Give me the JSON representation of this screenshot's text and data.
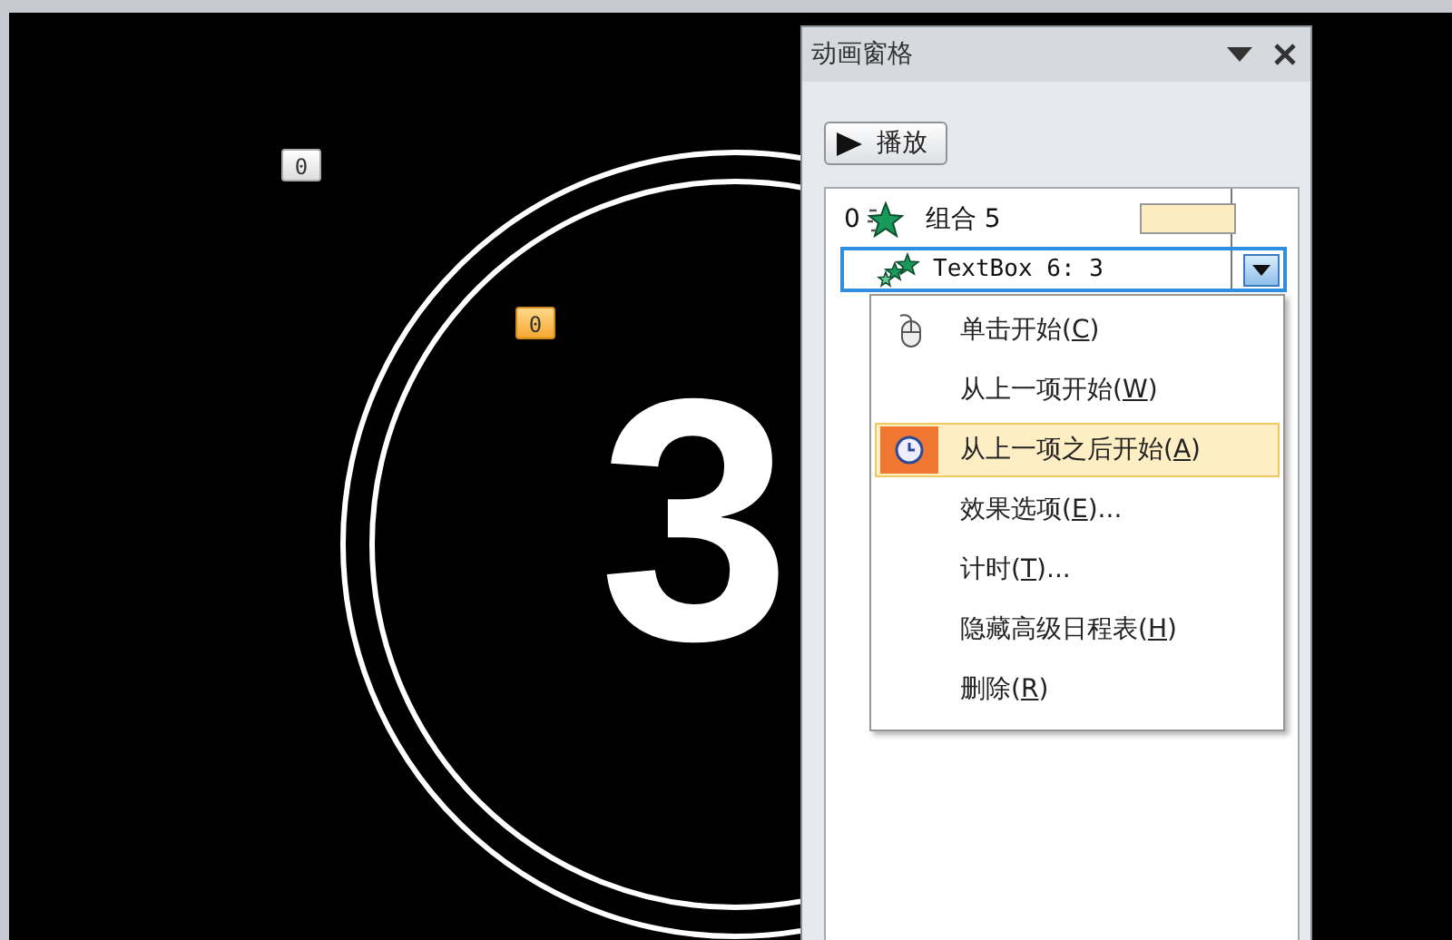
{
  "slide": {
    "badges": [
      {
        "text": "0",
        "selected": false
      },
      {
        "text": "0",
        "selected": true
      }
    ],
    "number": "3"
  },
  "animation_pane": {
    "title": "动画窗格",
    "play_button": {
      "label": "播放"
    },
    "items": [
      {
        "index": "0",
        "name": "组合 5",
        "kind": "group",
        "selected": false
      },
      {
        "name": "TextBox 6: 3",
        "kind": "effect",
        "selected": true
      }
    ],
    "context_menu": [
      {
        "before": "单击开始(",
        "key": "C",
        "after": ")",
        "kind": "mouse",
        "selected": false
      },
      {
        "before": "从上一项开始(",
        "key": "W",
        "after": ")",
        "selected": false
      },
      {
        "before": "从上一项之后开始(",
        "key": "A",
        "after": ")",
        "kind": "clock",
        "selected": true
      },
      {
        "before": "效果选项(",
        "key": "E",
        "after": ")...",
        "selected": false
      },
      {
        "before": "计时(",
        "key": "T",
        "after": ")...",
        "selected": false
      },
      {
        "before": "隐藏高级日程表(",
        "key": "H",
        "after": ")",
        "selected": false
      },
      {
        "before": "删除(",
        "key": "R",
        "after": ")",
        "selected": false
      }
    ]
  }
}
